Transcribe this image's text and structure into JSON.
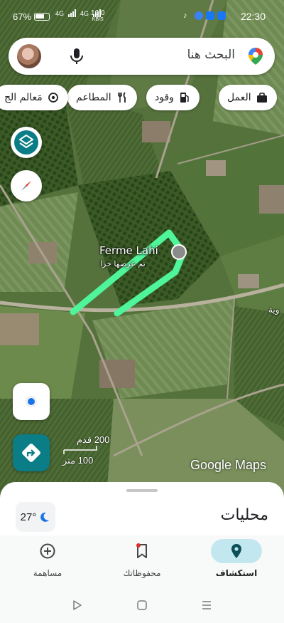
{
  "status_bar": {
    "battery": "67%",
    "network_speed_value": "16.0",
    "network_speed_unit": "KB/S",
    "signal_1": "4G",
    "signal_2": "4G",
    "time": "22:30"
  },
  "search": {
    "placeholder": "البحث هنا"
  },
  "chips": [
    {
      "label": "العمل",
      "icon": "briefcase-icon"
    },
    {
      "label": "وقود",
      "icon": "fuel-icon"
    },
    {
      "label": "المطاعم",
      "icon": "restaurant-icon"
    },
    {
      "label": "مَعالم الج",
      "icon": "landmark-icon"
    }
  ],
  "map": {
    "place_name": "Ferme Lahi",
    "place_sublabel": "تم عرضها خزا",
    "edge_label": "وية",
    "scale_top": "200 قدم",
    "scale_bottom": "100 متر",
    "attribution": "Google Maps",
    "drawn_route_color": "#4ff59a"
  },
  "sheet": {
    "title": "محليات",
    "temperature": "27°",
    "weather_icon": "moon-icon"
  },
  "bottom_nav": [
    {
      "label": "استكشاف",
      "icon": "explore-pin-icon",
      "active": true
    },
    {
      "label": "محفوظاتك",
      "icon": "bookmark-icon",
      "active": false
    },
    {
      "label": "مساهمة",
      "icon": "add-circle-icon",
      "active": false
    }
  ],
  "colors": {
    "accent_teal": "#0b7d86",
    "active_pill": "#c2e7ef",
    "location_blue": "#1a73e8"
  }
}
